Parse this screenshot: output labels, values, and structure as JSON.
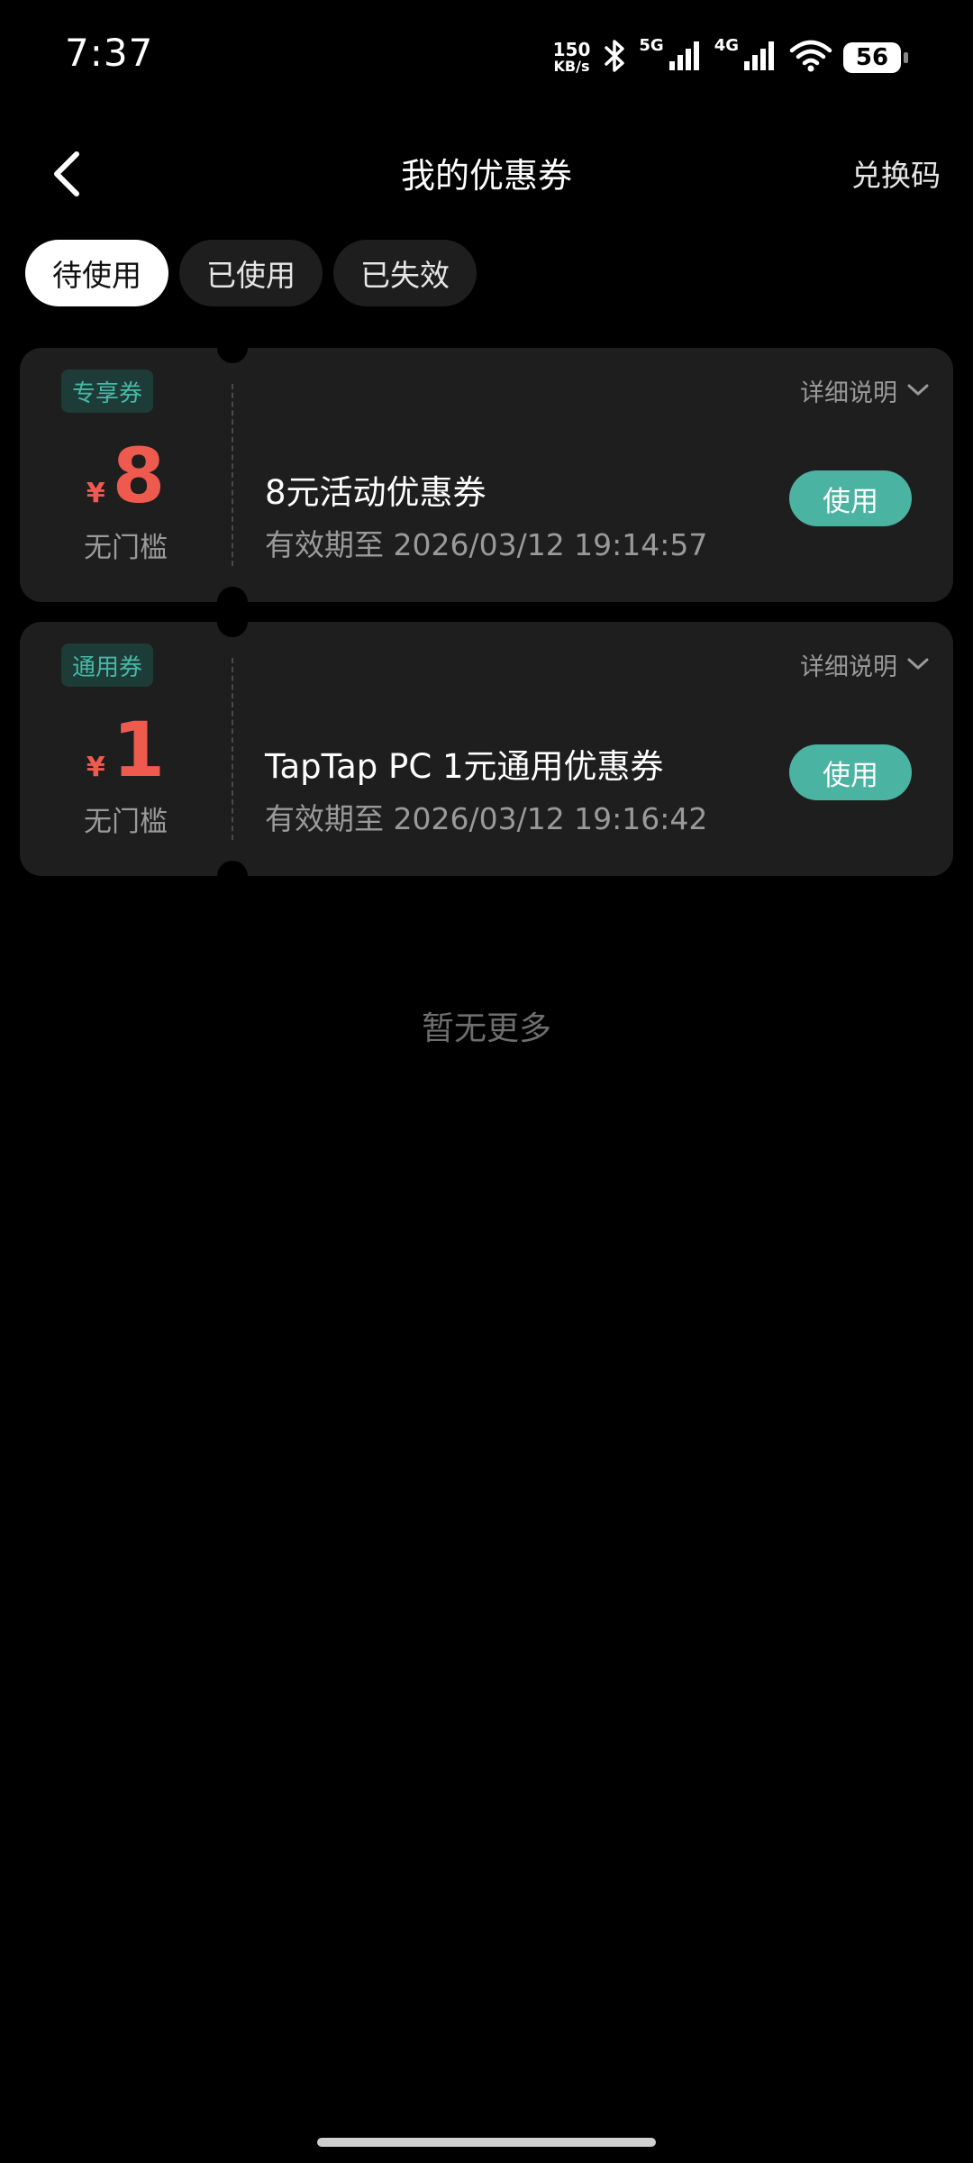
{
  "status_bar": {
    "time": "7:37",
    "net_speed_value": "150",
    "net_speed_unit": "KB/s",
    "signal_1_label": "5G",
    "signal_2_label": "4G",
    "battery": "56"
  },
  "header": {
    "title": "我的优惠券",
    "redeem_label": "兑换码"
  },
  "tabs": [
    {
      "label": "待使用",
      "active": true
    },
    {
      "label": "已使用",
      "active": false
    },
    {
      "label": "已失效",
      "active": false
    }
  ],
  "coupons": [
    {
      "tag": "专享券",
      "currency": "¥",
      "amount": "8",
      "threshold": "无门槛",
      "detail_label": "详细说明",
      "name": "8元活动优惠券",
      "expiry": "有效期至 2026/03/12 19:14:57",
      "action_label": "使用"
    },
    {
      "tag": "通用券",
      "currency": "¥",
      "amount": "1",
      "threshold": "无门槛",
      "detail_label": "详细说明",
      "name": "TapTap PC 1元通用优惠券",
      "expiry": "有效期至 2026/03/12 19:16:42",
      "action_label": "使用"
    }
  ],
  "footer": {
    "no_more_label": "暂无更多"
  },
  "colors": {
    "background": "#000000",
    "card": "#1e1e1e",
    "accent": "#4bb3a2",
    "amount": "#ef5a4f",
    "tag_text": "#48b8a6",
    "tag_bg": "#1d3b37"
  }
}
